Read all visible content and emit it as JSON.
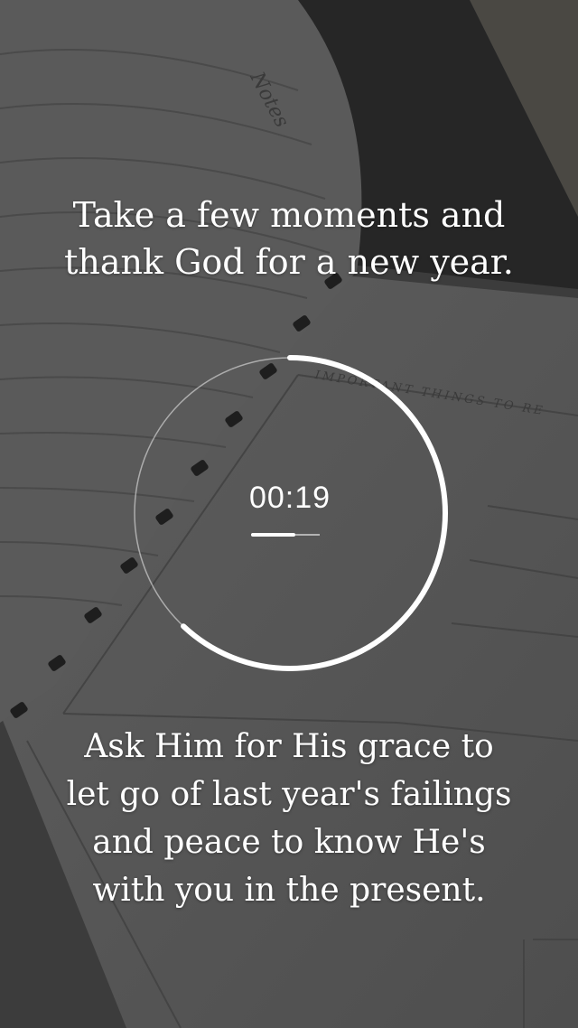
{
  "screen": {
    "prompt_text": "Take a few moments and thank God for a new year.",
    "instruction_text": "Ask Him for His grace to let go of last year's failings and peace to know He's with you in the present."
  },
  "background": {
    "notebook_page_title": "IMPORTANT THINGS TO RE",
    "notebook_tab_label": "Notes"
  },
  "timer": {
    "time_label": "00:19",
    "progress_fraction": 0.62,
    "bar_progress_fraction": 0.65,
    "ring_color": "#ffffff"
  }
}
